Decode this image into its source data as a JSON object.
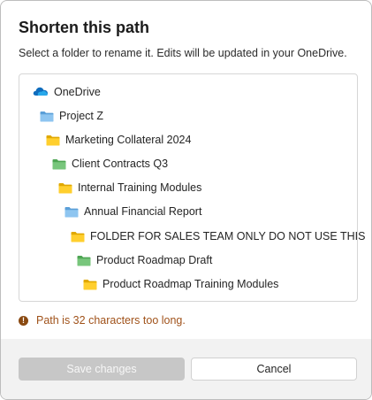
{
  "dialog": {
    "title": "Shorten this path",
    "subtitle": "Select a folder to rename it. Edits will be updated in your OneDrive."
  },
  "tree": {
    "items": [
      {
        "label": "OneDrive",
        "icon": "onedrive-cloud-icon",
        "color": "#0f6cbd"
      },
      {
        "label": "Project Z",
        "icon": "folder-icon",
        "color": "#7fb8e8"
      },
      {
        "label": "Marketing Collateral 2024",
        "icon": "folder-icon",
        "color": "#f5c518"
      },
      {
        "label": "Client Contracts Q3",
        "icon": "folder-icon",
        "color": "#6fbf73"
      },
      {
        "label": "Internal Training Modules",
        "icon": "folder-icon",
        "color": "#f5c518"
      },
      {
        "label": "Annual Financial Report",
        "icon": "folder-icon",
        "color": "#7fb8e8"
      },
      {
        "label": "FOLDER FOR SALES TEAM ONLY DO NOT USE THIS",
        "icon": "folder-icon",
        "color": "#f5c518"
      },
      {
        "label": "Product Roadmap Draft",
        "icon": "folder-icon",
        "color": "#6fbf73"
      },
      {
        "label": "Product Roadmap Training Modules",
        "icon": "folder-icon",
        "color": "#f5c518"
      }
    ]
  },
  "error": {
    "icon": "warning-icon",
    "text": "Path is 32 characters too long.",
    "color": "#a0521a"
  },
  "footer": {
    "save_label": "Save changes",
    "cancel_label": "Cancel"
  }
}
